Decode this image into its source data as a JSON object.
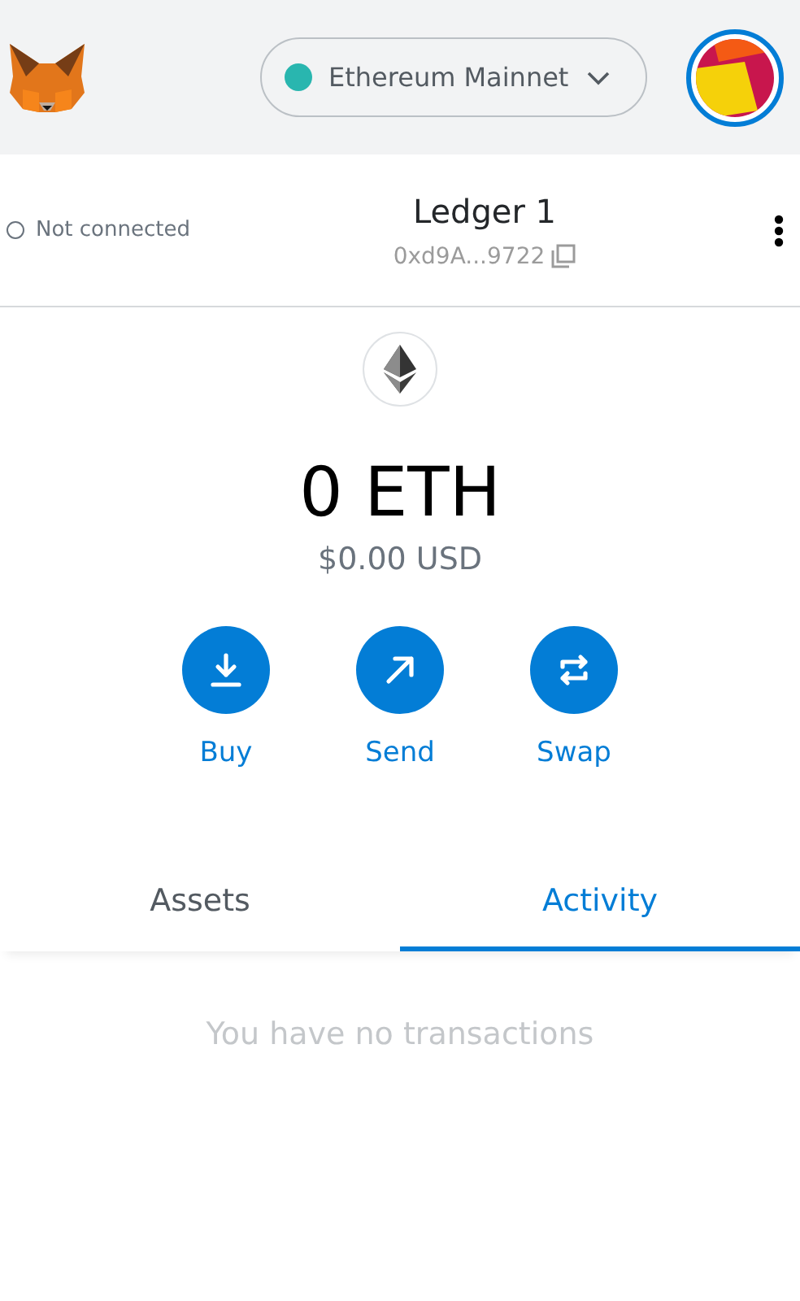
{
  "network": {
    "name": "Ethereum Mainnet",
    "color": "#29b6af"
  },
  "account": {
    "connection": {
      "label": "Not connected",
      "connected": false
    },
    "name": "Ledger 1",
    "address": "0xd9A...9722"
  },
  "balance": {
    "primary": "0 ETH",
    "secondary": "$0.00 USD"
  },
  "actions": [
    {
      "kind": "buy",
      "label": "Buy"
    },
    {
      "kind": "send",
      "label": "Send"
    },
    {
      "kind": "swap",
      "label": "Swap"
    }
  ],
  "tabs": [
    {
      "label": "Assets",
      "selected": false
    },
    {
      "label": "Activity",
      "selected": true
    }
  ],
  "empty_message": "You have no transactions"
}
